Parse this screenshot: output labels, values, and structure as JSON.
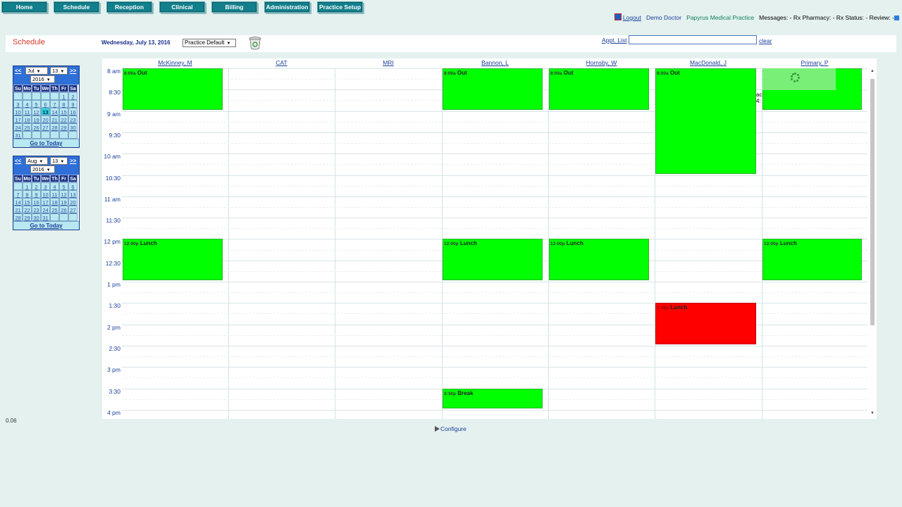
{
  "nav": {
    "items": [
      {
        "label": "Home"
      },
      {
        "label": "Schedule"
      },
      {
        "label": "Reception"
      },
      {
        "label": "Clinical"
      },
      {
        "label": "Billing"
      },
      {
        "label": "Administration"
      },
      {
        "label": "Practice Setup"
      }
    ]
  },
  "topinfo": {
    "logout": "Logout",
    "user": "Demo Doctor",
    "practice": "Papyrus Medical Practice",
    "messages": "Messages: -",
    "rx_pharmacy": "Rx Pharmacy: -",
    "rx_status": "Rx Status: -",
    "review": "Review: -"
  },
  "header": {
    "title": "Schedule",
    "date": "Wednesday, July 13, 2016",
    "view_select": "Practice Default",
    "appt_list_label": "Appt. List",
    "appt_list_value": "",
    "clear_label": "clear"
  },
  "calendars": [
    {
      "prev": "<<",
      "next": ">>",
      "month": "Jul",
      "day": "13",
      "year": "2016",
      "dow": [
        "Su",
        "Mo",
        "Tu",
        "We",
        "Th",
        "Fr",
        "Sa"
      ],
      "days": [
        "",
        "",
        "",
        "",
        "",
        "1",
        "2",
        "3",
        "4",
        "5",
        "6",
        "7",
        "8",
        "9",
        "10",
        "11",
        "12",
        "13",
        "14",
        "15",
        "16",
        "17",
        "18",
        "19",
        "20",
        "21",
        "22",
        "23",
        "24",
        "25",
        "26",
        "27",
        "28",
        "29",
        "30",
        "31",
        "",
        "",
        "",
        "",
        "",
        ""
      ],
      "today": "13",
      "go_today": "Go to Today"
    },
    {
      "prev": "<<",
      "next": ">>",
      "month": "Aug",
      "day": "13",
      "year": "2016",
      "dow": [
        "Su",
        "Mo",
        "Tu",
        "We",
        "Th",
        "Fr",
        "Sa"
      ],
      "days": [
        "",
        "1",
        "2",
        "3",
        "4",
        "5",
        "6",
        "7",
        "8",
        "9",
        "10",
        "11",
        "12",
        "13",
        "14",
        "15",
        "16",
        "17",
        "18",
        "19",
        "20",
        "21",
        "22",
        "23",
        "24",
        "25",
        "26",
        "27",
        "28",
        "29",
        "30",
        "31",
        "",
        "",
        ""
      ],
      "today": "",
      "go_today": "Go to Today"
    }
  ],
  "schedule": {
    "columns": [
      "McKinney, M",
      "CAT",
      "MRI",
      "Bannon, L",
      "Hornsby, W",
      "MacDonald, J",
      "Primary, P"
    ],
    "times": [
      "8 am",
      "8:30",
      "9 am",
      "9:30",
      "10 am",
      "10:30",
      "11 am",
      "11:30",
      "12 pm",
      "12:30",
      "1 pm",
      "1:30",
      "2 pm",
      "2:30",
      "3 pm",
      "3:30",
      "4 pm"
    ],
    "events": [
      {
        "col": 0,
        "start": 0,
        "dur": 2,
        "time": "8:00a",
        "label": "Out",
        "color": "green"
      },
      {
        "col": 3,
        "start": 0,
        "dur": 2,
        "time": "8:00a",
        "label": "Out",
        "color": "green"
      },
      {
        "col": 4,
        "start": 0,
        "dur": 2,
        "time": "8:00a",
        "label": "Out",
        "color": "green"
      },
      {
        "col": 5,
        "start": 0,
        "dur": 5,
        "time": "8:00a",
        "label": "Out",
        "color": "green"
      },
      {
        "col": 6,
        "start": 0,
        "dur": 2,
        "time": "8:00a",
        "label": "Out",
        "color": "green"
      },
      {
        "col": 0,
        "start": 8,
        "dur": 2,
        "time": "12:00p",
        "label": "Lunch",
        "color": "green"
      },
      {
        "col": 3,
        "start": 8,
        "dur": 2,
        "time": "12:00p",
        "label": "Lunch",
        "color": "green"
      },
      {
        "col": 4,
        "start": 8,
        "dur": 2,
        "time": "12:00p",
        "label": "Lunch",
        "color": "green"
      },
      {
        "col": 6,
        "start": 8,
        "dur": 2,
        "time": "12:00p",
        "label": "Lunch",
        "color": "green"
      },
      {
        "col": 5,
        "start": 11,
        "dur": 2,
        "time": "1:30p",
        "label": "Lunch",
        "color": "red"
      },
      {
        "col": 3,
        "start": 15,
        "dur": 1,
        "time": "3:30p",
        "label": "Break",
        "color": "green"
      }
    ],
    "overflow_text": "ac\n4:",
    "colors": {
      "green": "#00ff00",
      "red": "#ff0000"
    }
  },
  "version": "0.06",
  "configure_label": "Configure"
}
